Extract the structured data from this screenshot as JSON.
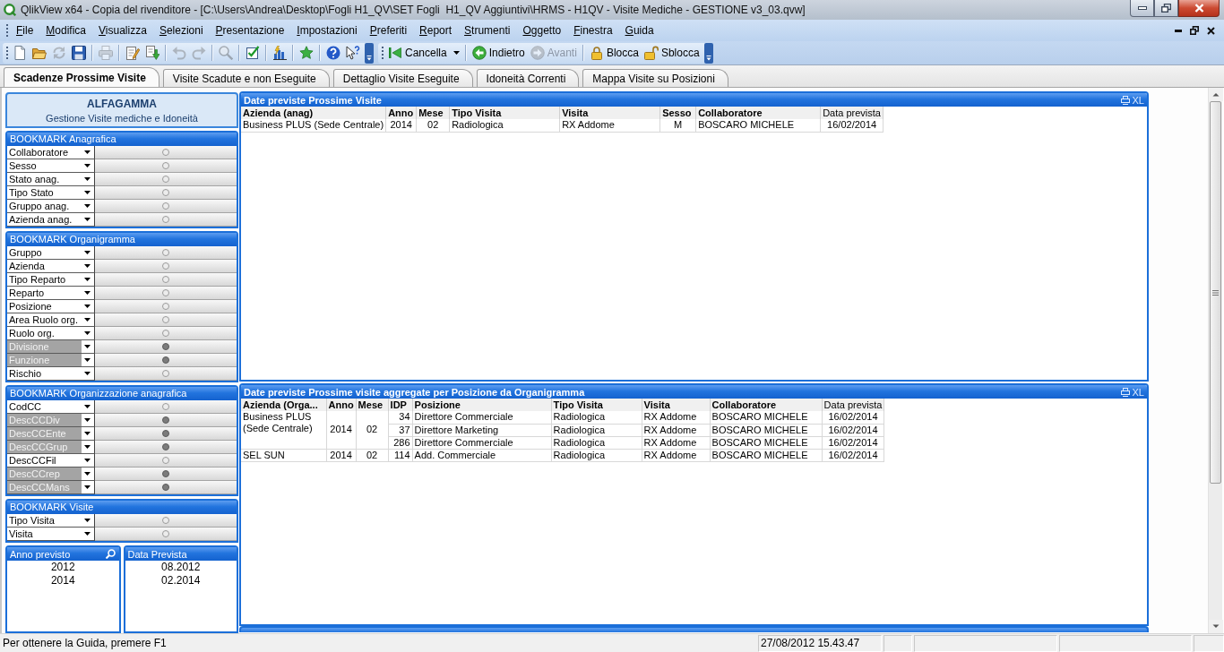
{
  "window": {
    "title": "QlikView x64 - Copia del rivenditore - [C:\\Users\\Andrea\\Desktop\\Fogli H1_QV\\SET Fogli  H1_QV Aggiuntivi\\HRMS - H1QV - Visite Mediche - GESTIONE v3_03.qvw]"
  },
  "menu": [
    "File",
    "Modifica",
    "Visualizza",
    "Selezioni",
    "Presentazione",
    "Impostazioni",
    "Preferiti",
    "Report",
    "Strumenti",
    "Oggetto",
    "Finestra",
    "Guida"
  ],
  "toolbar": {
    "groups": [
      [
        {
          "disabled": false
        },
        {
          "disabled": false
        },
        {
          "disabled": true
        },
        {
          "disabled": false
        }
      ],
      [
        {
          "disabled": true
        }
      ],
      [
        {
          "disabled": false
        },
        {
          "disabled": false
        }
      ],
      [
        {
          "disabled": true
        },
        {
          "disabled": true
        }
      ],
      [
        {
          "disabled": true
        }
      ],
      [
        {
          "disabled": false
        }
      ],
      [
        {
          "disabled": false
        }
      ],
      [
        {
          "disabled": false
        }
      ],
      [
        {
          "disabled": false
        },
        {
          "disabled": false
        }
      ]
    ]
  },
  "selection_toolbar": {
    "groups": [
      [
        {
          "label": "Cancella",
          "dropdown": true,
          "disabled": false
        }
      ],
      [
        {
          "label": "Indietro",
          "dropdown": false,
          "disabled": false
        },
        {
          "label": "Avanti",
          "dropdown": false,
          "disabled": true
        }
      ],
      [
        {
          "label": "Blocca",
          "dropdown": false,
          "disabled": false
        },
        {
          "label": "Sblocca",
          "dropdown": false,
          "disabled": false
        }
      ]
    ]
  },
  "tabs": [
    {
      "label": "Scadenze Prossime Visite",
      "selected": true
    },
    {
      "label": "Visite Scadute e non Eseguite",
      "selected": false
    },
    {
      "label": "Dettaglio Visite Eseguite",
      "selected": false
    },
    {
      "label": "Idoneità Correnti",
      "selected": false
    },
    {
      "label": "Mappa Visite su Posizioni",
      "selected": false
    }
  ],
  "sidebar": {
    "title": "ALFAGAMMA",
    "subtitle": "Gestione Visite mediche e Idoneità",
    "bookmark_groups": [
      {
        "title": "BOOKMARK Anagrafica",
        "rows": [
          {
            "label": "Collaboratore",
            "disabled": false
          },
          {
            "label": "Sesso",
            "disabled": false
          },
          {
            "label": "Stato anag.",
            "disabled": false
          },
          {
            "label": "Tipo Stato",
            "disabled": false
          },
          {
            "label": "Gruppo anag.",
            "disabled": false
          },
          {
            "label": "Azienda anag.",
            "disabled": false
          }
        ]
      },
      {
        "title": "BOOKMARK Organigramma",
        "rows": [
          {
            "label": "Gruppo",
            "disabled": false
          },
          {
            "label": "Azienda",
            "disabled": false
          },
          {
            "label": "Tipo Reparto",
            "disabled": false
          },
          {
            "label": "Reparto",
            "disabled": false
          },
          {
            "label": "Posizione",
            "disabled": false
          },
          {
            "label": "Area Ruolo org.",
            "disabled": false
          },
          {
            "label": "Ruolo org.",
            "disabled": false
          },
          {
            "label": "Divisione",
            "disabled": true
          },
          {
            "label": "Funzione",
            "disabled": true
          },
          {
            "label": "Rischio",
            "disabled": false
          }
        ]
      },
      {
        "title": "BOOKMARK Organizzazione anagrafica",
        "rows": [
          {
            "label": "CodCC",
            "disabled": false
          },
          {
            "label": "DescCCDiv",
            "disabled": true
          },
          {
            "label": "DescCCEnte",
            "disabled": true
          },
          {
            "label": "DescCCGrup",
            "disabled": true
          },
          {
            "label": "DescCCFil",
            "disabled": false
          },
          {
            "label": "DescCCrep",
            "disabled": true
          },
          {
            "label": "DescCCMans",
            "disabled": true
          }
        ]
      },
      {
        "title": "BOOKMARK Visite",
        "rows": [
          {
            "label": "Tipo Visita",
            "disabled": false
          },
          {
            "label": "Visita",
            "disabled": false
          }
        ]
      }
    ],
    "listboxes": [
      {
        "title": "Anno previsto",
        "search": true,
        "values": [
          "2012",
          "2014"
        ]
      },
      {
        "title": "Data Prevista",
        "search": false,
        "values": [
          "08.2012",
          "02.2014"
        ]
      }
    ]
  },
  "panels": [
    {
      "title": "Date previste Prossime Visite",
      "export_label": "XL",
      "columns": [
        "Azienda (anag)",
        "Anno",
        "Mese",
        "Tipo Visita",
        "Visita",
        "Sesso",
        "Collaboratore",
        "Data prevista"
      ],
      "groups": [
        {
          "rows": [
            [
              "Business PLUS (Sede Centrale)",
              "2014",
              "02",
              "Radiologica",
              "RX Addome",
              "M",
              "BOSCARO MICHELE",
              "16/02/2014"
            ]
          ]
        }
      ]
    },
    {
      "title": "Date previste Prossime visite aggregate per Posizione da Organigramma",
      "export_label": "XL",
      "columns": [
        "Azienda (Orga...",
        "Anno",
        "Mese",
        "IDP",
        "Posizione",
        "Tipo Visita",
        "Visita",
        "Collaboratore",
        "Data prevista"
      ],
      "groups": [
        {
          "cells": [
            "Business PLUS (Sede Centrale)",
            "2014",
            "02"
          ],
          "rows": [
            [
              "34",
              "Direttore Commerciale",
              "Radiologica",
              "RX Addome",
              "BOSCARO MICHELE",
              "16/02/2014"
            ],
            [
              "37",
              "Direttore Marketing",
              "Radiologica",
              "RX Addome",
              "BOSCARO MICHELE",
              "16/02/2014"
            ],
            [
              "286",
              "Direttore Commerciale",
              "Radiologica",
              "RX Addome",
              "BOSCARO MICHELE",
              "16/02/2014"
            ]
          ]
        },
        {
          "cells": [
            "SEL SUN",
            "2014",
            "02"
          ],
          "rows": [
            [
              "114",
              "Add. Commerciale",
              "Radiologica",
              "RX Addome",
              "BOSCARO MICHELE",
              "16/02/2014"
            ]
          ]
        }
      ]
    }
  ],
  "status_bar": {
    "help_text": "Per ottenere la Guida, premere F1",
    "datetime": "27/08/2012 15.43.47"
  }
}
